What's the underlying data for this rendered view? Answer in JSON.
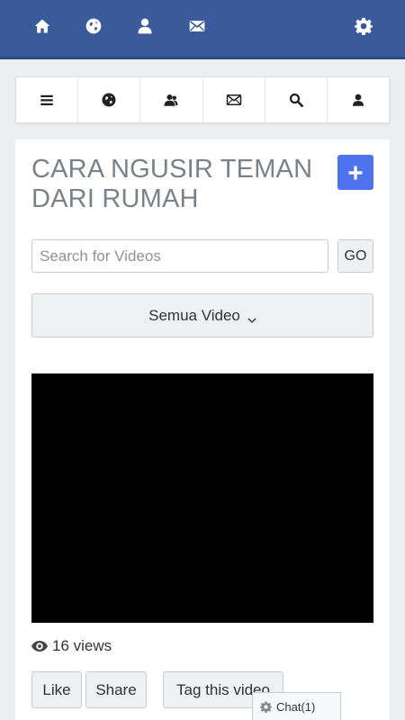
{
  "topbar": {
    "icons": [
      "home-icon",
      "globe-icon",
      "user-icon",
      "envelope-icon",
      "gear-icon"
    ]
  },
  "nav2": {
    "icons": [
      "menu-icon",
      "globe-icon",
      "friends-icon",
      "envelope-icon",
      "search-icon",
      "user-icon"
    ]
  },
  "main": {
    "title": "CARA NGUSIR TEMAN DARI RUMAH",
    "search_placeholder": "Search for Videos",
    "go_label": "GO",
    "dropdown_selected": "Semua Video",
    "views_text": "16 views",
    "like_label": "Like",
    "share_label": "Share",
    "tag_label": "Tag this video"
  },
  "chat": {
    "label": "Chat(1)"
  },
  "colors": {
    "topbar_bg": "#3a5a9c",
    "accent_button": "#4f72ef",
    "title_text": "#7b8287",
    "video_bg": "#000000"
  }
}
